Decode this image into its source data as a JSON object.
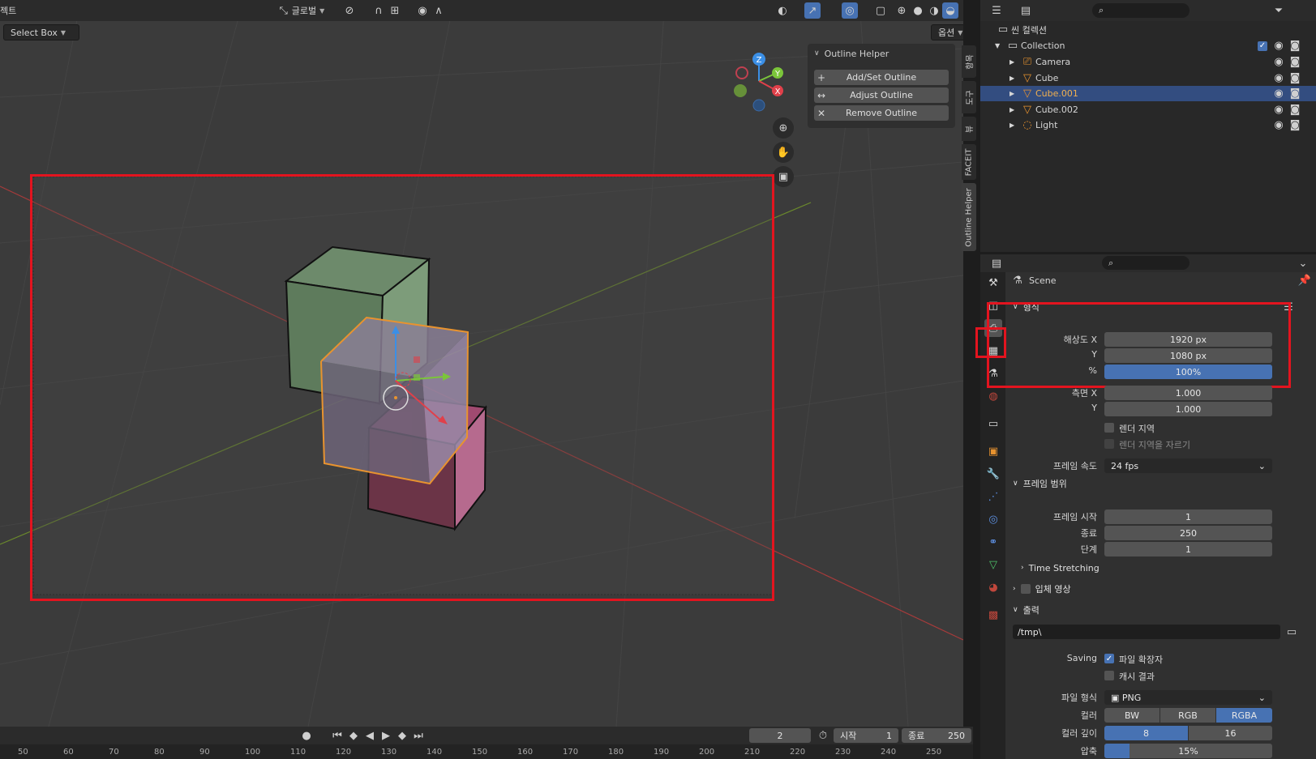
{
  "viewport_header": {
    "mode_label": "젝트",
    "select_label": "Select Box",
    "transform_label": "글로벌",
    "options_label": "옵션"
  },
  "outline_helper": {
    "title": "Outline Helper",
    "buttons": [
      "Add/Set Outline",
      "Adjust Outline",
      "Remove Outline"
    ]
  },
  "side_tabs": [
    "항목",
    "도구",
    "뷰",
    "FACEIT",
    "Outline Helper"
  ],
  "gizmo": {
    "x": "X",
    "y": "Y",
    "z": "Z"
  },
  "outliner": {
    "scene_collection": "씬 컬렉션",
    "collection": "Collection",
    "items": [
      {
        "name": "Camera",
        "selected": false
      },
      {
        "name": "Cube",
        "selected": false
      },
      {
        "name": "Cube.001",
        "selected": true
      },
      {
        "name": "Cube.002",
        "selected": false
      },
      {
        "name": "Light",
        "selected": false
      }
    ]
  },
  "properties": {
    "scene_label": "Scene",
    "format": {
      "title": "형식",
      "res_x_label": "해상도 X",
      "res_x": "1920 px",
      "res_y_label": "Y",
      "res_y": "1080 px",
      "pct_label": "%",
      "pct": "100%",
      "aspect_x_label": "측면 X",
      "aspect_x": "1.000",
      "aspect_y_label": "Y",
      "aspect_y": "1.000",
      "render_region": "렌더 지역",
      "crop_region": "렌더 지역을 자르기",
      "fps_label": "프레임 속도",
      "fps": "24 fps"
    },
    "frame_range": {
      "title": "프레임 범위",
      "start_label": "프레임 시작",
      "start": "1",
      "end_label": "종료",
      "end": "250",
      "step_label": "단계",
      "step": "1",
      "time_stretching": "Time Stretching"
    },
    "stereo": {
      "title": "입체 영상"
    },
    "output": {
      "title": "출력",
      "path": "/tmp\\",
      "saving_label": "Saving",
      "file_ext": "파일 확장자",
      "cache_result": "캐시 결과",
      "file_format_label": "파일 형식",
      "file_format": "PNG",
      "color_label": "컬러",
      "color_options": [
        "BW",
        "RGB",
        "RGBA"
      ],
      "color_depth_label": "컬러 깊이",
      "color_depth_options": [
        "8",
        "16"
      ],
      "compression_label": "압축",
      "compression": "15%"
    }
  },
  "timeline": {
    "current_frame": "2",
    "start_label": "시작",
    "start": "1",
    "end_label": "종료",
    "end": "250",
    "ruler": [
      "50",
      "60",
      "70",
      "80",
      "90",
      "100",
      "110",
      "120",
      "130",
      "140",
      "150",
      "160",
      "170",
      "180",
      "190",
      "200",
      "210",
      "220",
      "230",
      "240",
      "250"
    ]
  }
}
